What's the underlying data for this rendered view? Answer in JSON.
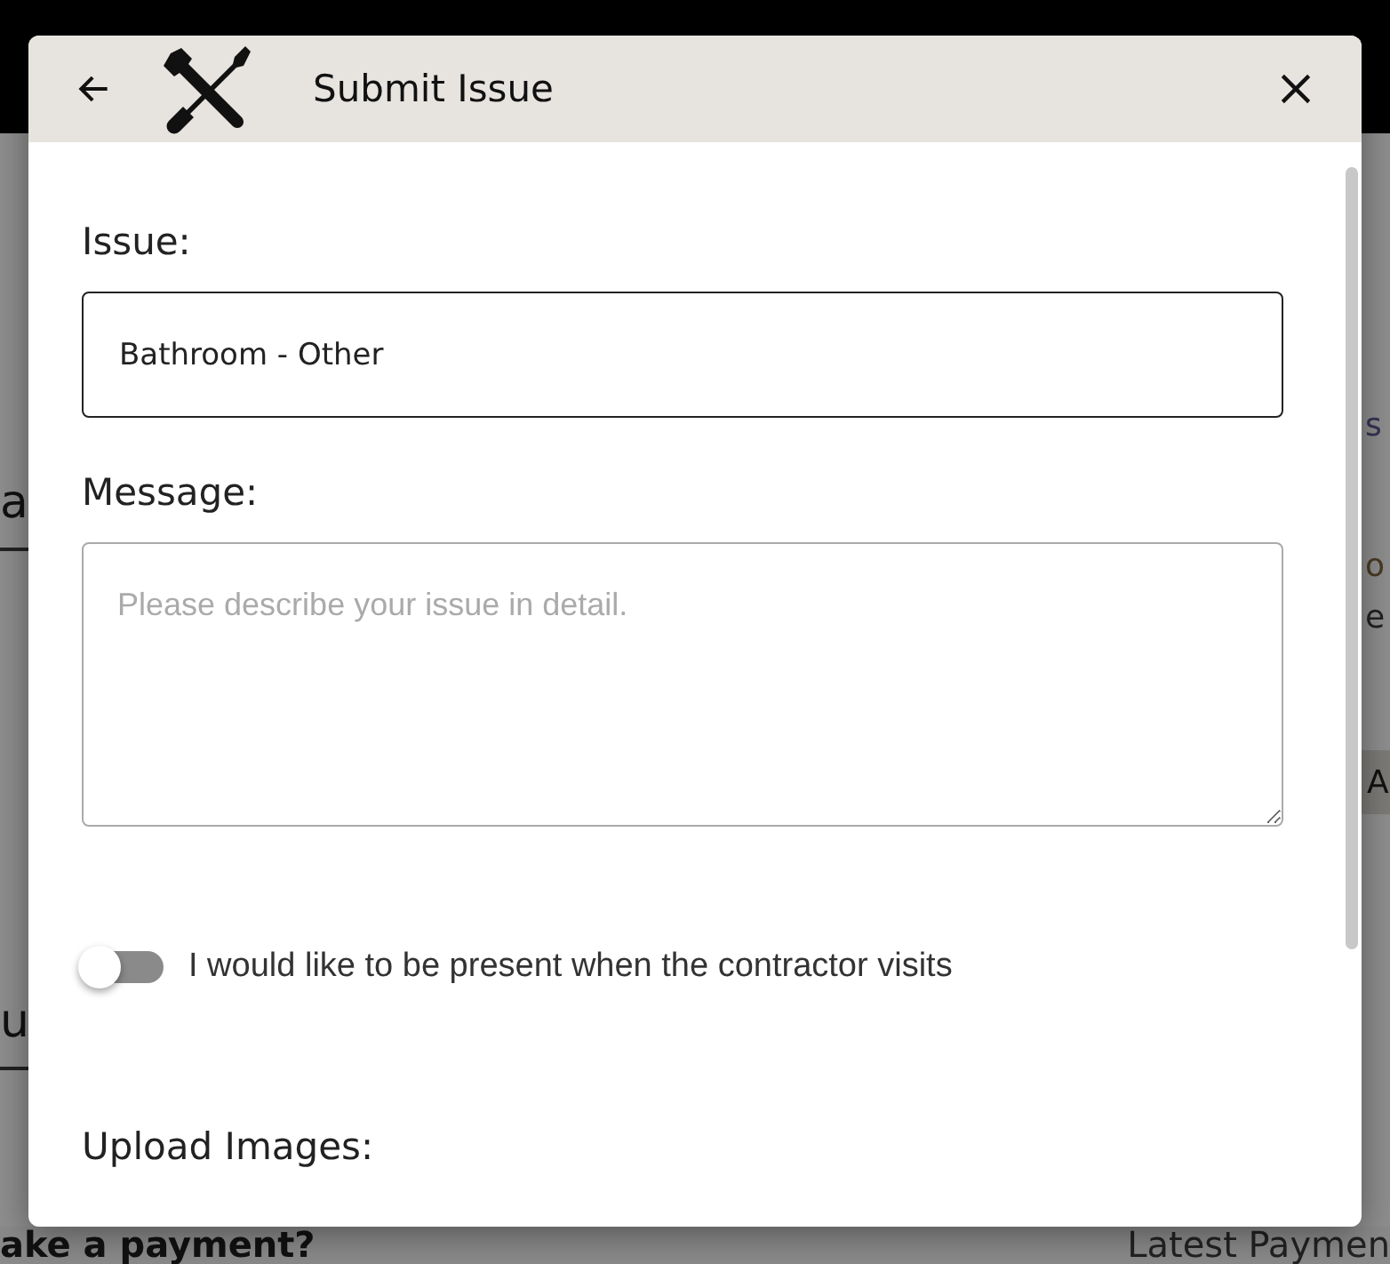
{
  "background": {
    "left_texts": [
      "a",
      "u"
    ],
    "right_texts": [
      "s",
      "o",
      "e"
    ],
    "right_button": "A",
    "bottom_left": "ake a payment?",
    "bottom_right": "Latest Paymen"
  },
  "dialog": {
    "title": "Submit Issue",
    "issue": {
      "label": "Issue:",
      "value": "Bathroom - Other"
    },
    "message": {
      "label": "Message:",
      "placeholder": "Please describe your issue in detail."
    },
    "toggle": {
      "label": "I would like to be present when the contractor visits",
      "on": false
    },
    "upload": {
      "label": "Upload Images:"
    }
  }
}
